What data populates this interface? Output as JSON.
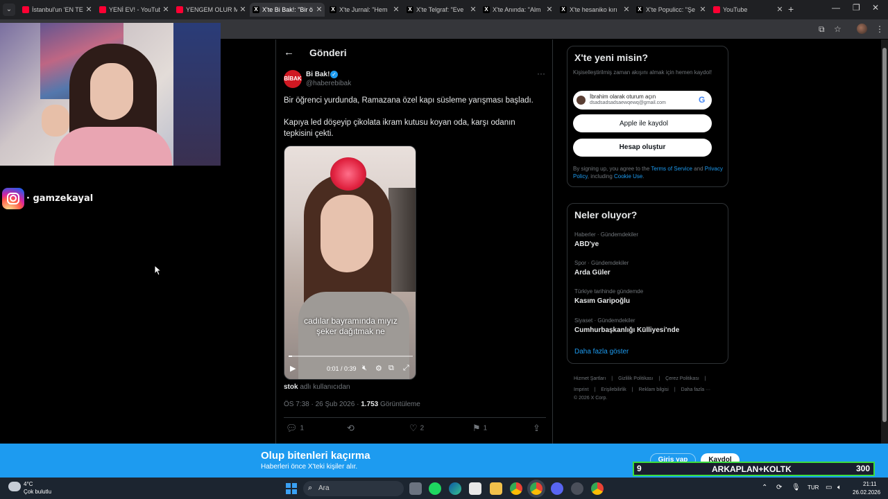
{
  "browser": {
    "tabs": [
      {
        "title": "İstanbul'un 'EN TE",
        "favicon": "youtube-icon"
      },
      {
        "title": "YENİ EV! - YouTub",
        "favicon": "youtube-icon"
      },
      {
        "title": "YENGEM OLUR M",
        "favicon": "youtube-icon"
      },
      {
        "title": "X'te Bi Bak!: \"Bir ö",
        "favicon": "x-icon",
        "active": true
      },
      {
        "title": "X'te Jurnal: \"Hem",
        "favicon": "x-icon"
      },
      {
        "title": "X'te Telgraf: \"Eve",
        "favicon": "x-icon"
      },
      {
        "title": "X'te Anında: \"Alm",
        "favicon": "x-icon"
      },
      {
        "title": "X'te hesaniko kırı",
        "favicon": "x-icon"
      },
      {
        "title": "X'te Populicc: \"Şe",
        "favicon": "x-icon"
      },
      {
        "title": "YouTube",
        "favicon": "youtube-icon"
      }
    ]
  },
  "stream": {
    "instagram_handle": "· gamzekayal"
  },
  "tweet": {
    "header_title": "Gönderi",
    "author_name": "Bi Bak!",
    "author_handle": "@haberebibak",
    "avatar_text": "BİBAK",
    "text_line1": "Bir öğrenci yurdunda, Ramazana özel kapı süsleme yarışması başladı.",
    "text_line2": "Kapıya led döşeyip çikolata ikram kutusu koyan oda, karşı odanın tepkisini çekti.",
    "video_caption_1": "cadılar bayramında mıyız",
    "video_caption_2": "şeker dağıtmak ne",
    "video_time": "0:01 / 0:39",
    "video_progress": 0.03,
    "via_user": "stok",
    "via_suffix": " adlı kullanıcıdan",
    "time_date": "ÖS 7:38 · 26 Şub 2026 · ",
    "views": "1.753",
    "views_label": " Görüntüleme",
    "replies": "1",
    "retweets": "",
    "likes": "2",
    "bookmarks": "1"
  },
  "signup": {
    "title": "X'te yeni misin?",
    "subtitle": "Kişiselleştirilmiş zaman akışını almak için hemen kaydol!",
    "google_line1": "İbrahim olarak oturum açın",
    "google_line2": "dsadsadsadsaewqewq@gmail.com",
    "apple_label": "Apple ile kaydol",
    "create_label": "Hesap oluştur",
    "terms_1": "By signing up, you agree to the ",
    "terms_tos": "Terms of Service",
    "terms_2": " and ",
    "terms_privacy": "Privacy Policy",
    "terms_3": ", including ",
    "terms_cookie": "Cookie Use",
    "terms_4": "."
  },
  "trends": {
    "title": "Neler oluyor?",
    "items": [
      {
        "category": "Haberler · Gündemdekiler",
        "name": "ABD'ye"
      },
      {
        "category": "Spor · Gündemdekiler",
        "name": "Arda Güler"
      },
      {
        "category": "Türkiye tarihinde gündemde",
        "name": "Kasım Garipoğlu"
      },
      {
        "category": "Siyaset · Gündemdekiler",
        "name": "Cumhurbaşkanlığı Külliyesi'nde"
      }
    ],
    "show_more": "Daha fazla göster"
  },
  "footer": {
    "links": [
      "Hizmet Şartları",
      "|",
      "Gizlilik Politikası",
      "|",
      "Çerez Politikası",
      "|",
      "Imprint",
      "|",
      "Erişilebilirlik",
      "|",
      "Reklam bilgisi",
      "|",
      "Daha fazla ···"
    ],
    "copyright": "© 2026 X Corp."
  },
  "banner": {
    "title": "Olup bitenleri kaçırma",
    "subtitle": "Haberleri önce X'teki kişiler alır.",
    "login": "Giriş yap",
    "register": "Kaydol"
  },
  "overlay": {
    "left": "9",
    "middle": "ARKAPLAN+KOLTK",
    "right": "300"
  },
  "taskbar": {
    "weather_temp": "4°C",
    "weather_desc": "Çok bulutlu",
    "search_placeholder": "Ara",
    "lang": "TUR",
    "time": "21:11",
    "date": "26.02.2026"
  },
  "colors": {
    "accent": "#1d9bf0",
    "background": "#000000",
    "overlay_border": "#3ddc3d"
  }
}
